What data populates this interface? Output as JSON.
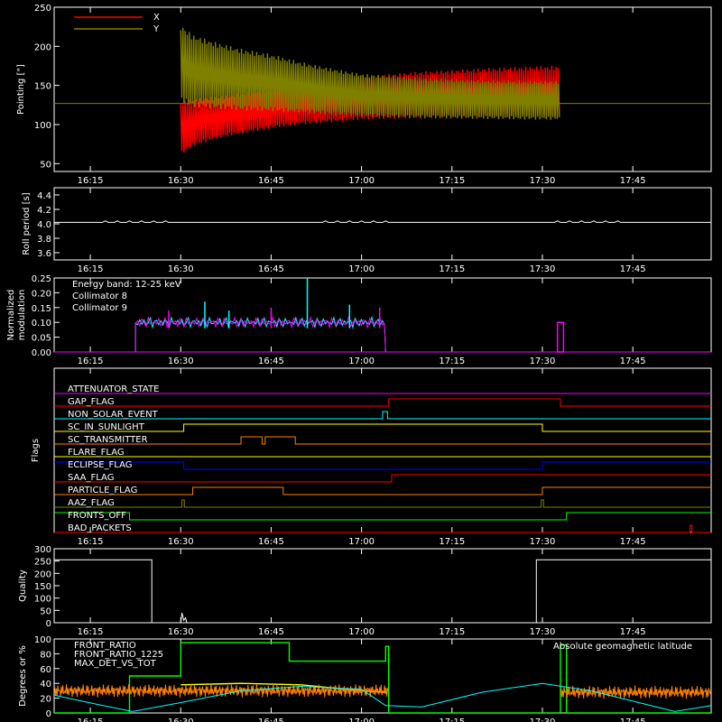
{
  "time_axis": {
    "ticks": [
      "16:15",
      "16:30",
      "16:45",
      "17:00",
      "17:15",
      "17:30",
      "17:45"
    ],
    "tick_minutes": [
      975,
      990,
      1005,
      1020,
      1035,
      1050,
      1065
    ],
    "range_minutes": [
      969,
      1078
    ]
  },
  "chart_data": [
    {
      "type": "line",
      "id": "pointing",
      "ylabel": "Pointing [\"]",
      "ylim": [
        40,
        250
      ],
      "yticks": [
        50,
        100,
        150,
        200,
        250
      ],
      "legend": [
        {
          "name": "X",
          "color": "#ff0000"
        },
        {
          "name": "Y",
          "color": "#808000"
        }
      ],
      "baseline": {
        "y": 127,
        "color": "#808000"
      },
      "series": [
        {
          "name": "X",
          "color": "#ff0000",
          "x": [
            990,
            992,
            996,
            1000,
            1005,
            1010,
            1015,
            1020,
            1030,
            1040,
            1050,
            1053
          ],
          "upper": [
            130,
            133,
            136,
            140,
            145,
            150,
            156,
            162,
            168,
            172,
            175,
            175
          ],
          "lower": [
            60,
            72,
            82,
            88,
            95,
            100,
            103,
            106,
            108,
            108,
            108,
            108
          ]
        },
        {
          "name": "Y",
          "color": "#808000",
          "x": [
            990,
            992,
            996,
            1000,
            1005,
            1010,
            1015,
            1020,
            1030,
            1040,
            1050,
            1053
          ],
          "upper": [
            228,
            215,
            205,
            197,
            190,
            180,
            172,
            165,
            160,
            157,
            156,
            156
          ],
          "lower": [
            128,
            122,
            120,
            118,
            117,
            115,
            112,
            110,
            108,
            107,
            106,
            106
          ]
        }
      ]
    },
    {
      "type": "line",
      "id": "roll",
      "ylabel": "Roll period [s]",
      "ylim": [
        3.5,
        4.5
      ],
      "yticks": [
        3.6,
        3.8,
        4.0,
        4.2,
        4.4
      ],
      "ytick_labels": [
        "3.6",
        "3.8",
        "4.0",
        "4.2",
        "4.4"
      ],
      "series": [
        {
          "name": "",
          "color": "#ffffff",
          "x": [
            969,
            1078
          ],
          "values": [
            4.02,
            4.02
          ]
        }
      ]
    },
    {
      "type": "bar",
      "id": "modulation",
      "ylabel": "Normalized modulation",
      "ylim": [
        0,
        0.25
      ],
      "yticks": [
        0.0,
        0.05,
        0.1,
        0.15,
        0.2,
        0.25
      ],
      "ytick_labels": [
        "0.00",
        "0.05",
        "0.10",
        "0.15",
        "0.20",
        "0.25"
      ],
      "annotation": "Energy band: 12-25 keV",
      "series": [
        {
          "name": "Collimator 8",
          "color": "#00ffff",
          "x_range": [
            982.5,
            1024
          ],
          "typical": 0.1
        },
        {
          "name": "Collimator 9",
          "color": "#ff00ff",
          "x_range": [
            982.5,
            1024
          ],
          "typical": 0.1
        }
      ],
      "spikes": [
        {
          "x": 998,
          "value": 0.14,
          "color": "#00ffff"
        },
        {
          "x": 1011,
          "value": 0.25,
          "color": "#00ffff"
        },
        {
          "x": 1005,
          "value": 0.15,
          "color": "#ff00ff"
        },
        {
          "x": 1018,
          "value": 0.16,
          "color": "#00ffff"
        },
        {
          "x": 1023,
          "value": 0.15,
          "color": "#ff00ff"
        },
        {
          "x": 994,
          "value": 0.17,
          "color": "#00ffff"
        },
        {
          "x": 988,
          "value": 0.14,
          "color": "#ff00ff"
        }
      ],
      "late_block": {
        "x_range": [
          1052.5,
          1053.5
        ],
        "value": 0.1,
        "color": "#ff00ff"
      }
    },
    {
      "type": "line",
      "id": "flags",
      "ylabel": "Flags",
      "rows": [
        {
          "name": "ATTENUATOR_STATE",
          "color": "#ff00ff",
          "steps": [
            [
              969,
              0
            ]
          ]
        },
        {
          "name": "GAP_FLAG",
          "color": "#ff0000",
          "steps": [
            [
              969,
              0
            ],
            [
              1024.5,
              1
            ],
            [
              1053,
              0
            ]
          ]
        },
        {
          "name": "NON_SOLAR_EVENT",
          "color": "#00ffff",
          "steps": [
            [
              969,
              0
            ],
            [
              1023.5,
              1
            ],
            [
              1024.3,
              0
            ]
          ]
        },
        {
          "name": "SC_IN_SUNLIGHT",
          "color": "#ffff00",
          "steps": [
            [
              969,
              0
            ],
            [
              990.5,
              1
            ],
            [
              1050,
              0
            ]
          ]
        },
        {
          "name": "SC_TRANSMITTER",
          "color": "#ff8000",
          "steps": [
            [
              969,
              0
            ],
            [
              1000,
              1
            ],
            [
              1003.5,
              0
            ],
            [
              1004,
              1
            ],
            [
              1009,
              0
            ]
          ]
        },
        {
          "name": "FLARE_FLAG",
          "color": "#ffff00",
          "steps": [
            [
              969,
              0
            ]
          ]
        },
        {
          "name": "ECLIPSE_FLAG",
          "color": "#0000ff",
          "steps": [
            [
              969,
              1
            ],
            [
              990.5,
              0
            ],
            [
              1050,
              1
            ]
          ]
        },
        {
          "name": "SAA_FLAG",
          "color": "#ff0000",
          "steps": [
            [
              969,
              0
            ],
            [
              1025,
              1
            ],
            [
              1078,
              1
            ]
          ]
        },
        {
          "name": "PARTICLE_FLAG",
          "color": "#ff8000",
          "steps": [
            [
              969,
              0
            ],
            [
              992,
              1
            ],
            [
              996.5,
              1
            ],
            [
              1001,
              1
            ],
            [
              1007,
              0
            ],
            [
              1024,
              0
            ],
            [
              1050,
              1
            ],
            [
              1078,
              1
            ]
          ]
        },
        {
          "name": "AAZ_FLAG",
          "color": "#808000",
          "steps": [
            [
              969,
              0
            ],
            [
              990.2,
              1
            ],
            [
              990.6,
              0
            ],
            [
              1049.8,
              1
            ],
            [
              1050.2,
              0
            ]
          ]
        },
        {
          "name": "FRONTS_OFF",
          "color": "#00ff00",
          "steps": [
            [
              969,
              1
            ],
            [
              981.5,
              0
            ],
            [
              1054,
              1
            ]
          ]
        },
        {
          "name": "BAD_PACKETS",
          "color": "#ff0000",
          "steps": [
            [
              969,
              0
            ],
            [
              1074.5,
              1
            ],
            [
              1074.8,
              0
            ]
          ]
        }
      ]
    },
    {
      "type": "line",
      "id": "quality",
      "ylabel": "Quality",
      "ylim": [
        0,
        300
      ],
      "yticks": [
        0,
        50,
        100,
        150,
        200,
        250,
        300
      ],
      "series": [
        {
          "name": "",
          "color": "#ffffff",
          "x": [
            969,
            985.2,
            985.2,
            990,
            990.2,
            990.5,
            990.8,
            991,
            1049,
            1049,
            1078
          ],
          "values": [
            255,
            255,
            0,
            0,
            40,
            10,
            20,
            0,
            0,
            255,
            255
          ]
        }
      ]
    },
    {
      "type": "line",
      "id": "fronts",
      "ylabel": "Degrees or %",
      "ylim": [
        0,
        100
      ],
      "yticks": [
        0,
        20,
        40,
        60,
        80,
        100
      ],
      "annotation": "Absolute geomagnetic latitude",
      "legend": [
        {
          "name": "FRONT_RATIO",
          "color": "#ffff00"
        },
        {
          "name": "FRONT_RATIO_1225",
          "color": "#00ff00"
        },
        {
          "name": "MAX_DET_VS_TOT",
          "color": "#ff8000"
        }
      ],
      "series": [
        {
          "name": "FRONT_RATIO_1225",
          "color": "#00ff00",
          "x": [
            969,
            981.5,
            981.5,
            990,
            990,
            1008,
            1008,
            1024,
            1024,
            1024.5,
            1024.5,
            1053,
            1053,
            1054,
            1054,
            1078
          ],
          "values": [
            0,
            0,
            50,
            50,
            95,
            95,
            70,
            70,
            90,
            90,
            0,
            0,
            92,
            92,
            0,
            0
          ]
        },
        {
          "name": "FRONT_RATIO",
          "color": "#ffff00",
          "x": [
            990,
            1000,
            1010,
            1020,
            1024
          ],
          "values": [
            38,
            40,
            38,
            30,
            28
          ]
        },
        {
          "name": "MAX_DET_VS_TOT",
          "color": "#ff8000",
          "x_range": [
            969,
            1024.5
          ],
          "level": 30,
          "x_range2": [
            1053,
            1078
          ],
          "level2": 28
        },
        {
          "name": "Absolute geomagnetic latitude",
          "color": "#00ffff",
          "x": [
            969,
            976,
            982,
            990,
            1000,
            1010,
            1020,
            1024,
            1030,
            1040,
            1050,
            1058,
            1066,
            1072,
            1078
          ],
          "values": [
            24,
            12,
            2,
            14,
            30,
            36,
            32,
            10,
            8,
            28,
            40,
            30,
            14,
            2,
            10
          ]
        }
      ]
    }
  ]
}
